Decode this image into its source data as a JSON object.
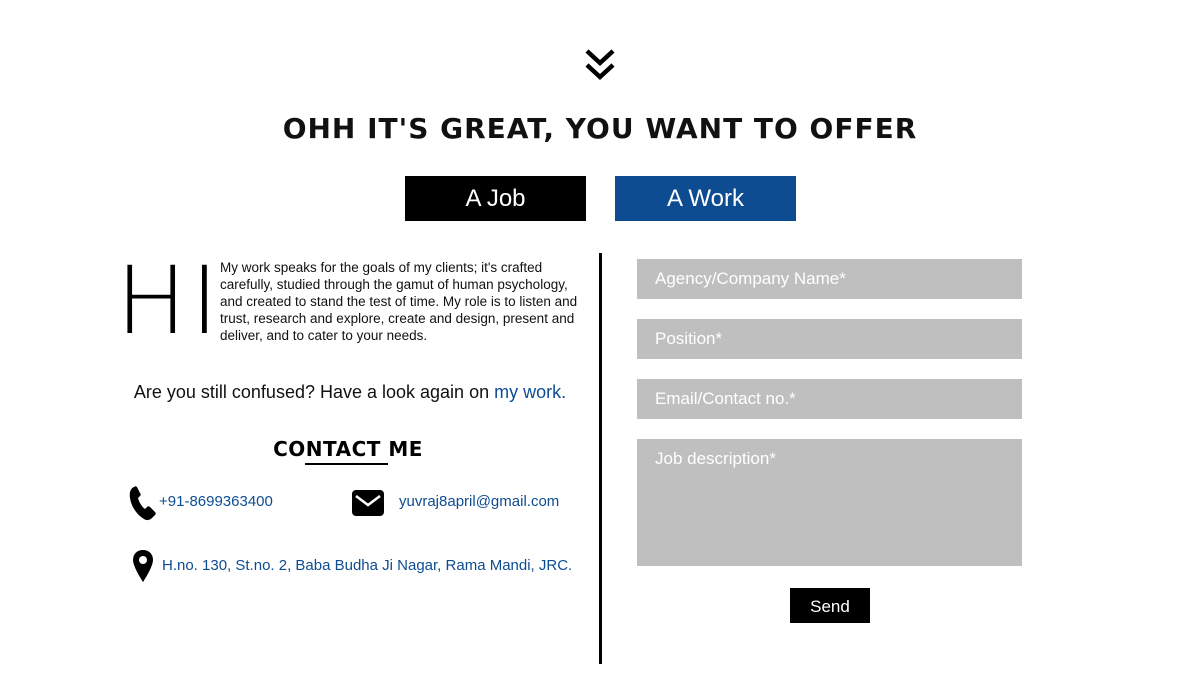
{
  "header": {
    "scroll_icon": "double-chevron-down",
    "headline": "OHH IT'S GREAT, YOU WANT TO OFFER"
  },
  "offer_tabs": {
    "job_label": "A Job",
    "work_label": "A Work"
  },
  "intro": {
    "greeting": "HI",
    "text": "My work speaks for the goals of my clients; it's crafted carefully, studied through the gamut of human psychology, and created to stand the test of time. My role is to listen and trust, research and explore, create and design, present and deliver, and to cater to your needs."
  },
  "confused": {
    "text": "Are you still confused? Have a look again on ",
    "link_label": "my work."
  },
  "contact": {
    "title": "CONTACT ME",
    "phone": "+91-8699363400",
    "email": "yuvraj8april@gmail.com",
    "address": "H.no. 130, St.no. 2, Baba Budha Ji Nagar, Rama Mandi, JRC."
  },
  "form": {
    "company_placeholder": "Agency/Company Name*",
    "position_placeholder": "Position*",
    "contact_placeholder": "Email/Contact no.*",
    "description_placeholder": "Job description*",
    "send_label": "Send"
  },
  "colors": {
    "accent_blue": "#0e4c92",
    "field_gray": "#bfbfbf",
    "black": "#000000"
  }
}
